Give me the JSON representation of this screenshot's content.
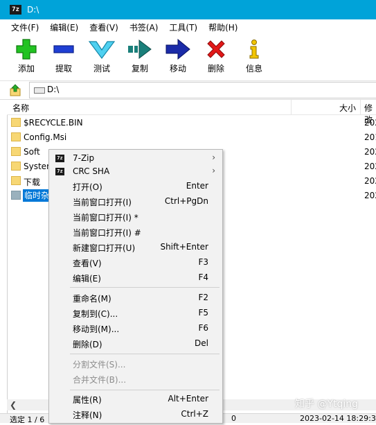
{
  "window": {
    "title": "D:\\",
    "icon_text": "7z"
  },
  "menubar": [
    "文件(F)",
    "编辑(E)",
    "查看(V)",
    "书签(A)",
    "工具(T)",
    "帮助(H)"
  ],
  "toolbar": {
    "add": "添加",
    "extract": "提取",
    "test": "测试",
    "copy": "复制",
    "move": "移动",
    "delete": "删除",
    "info": "信息"
  },
  "address": {
    "path": "D:\\"
  },
  "columns": {
    "name": "名称",
    "size": "大小",
    "modified": "修改"
  },
  "files": [
    {
      "name": "$RECYCLE.BIN",
      "date": "202"
    },
    {
      "name": "Config.Msi",
      "date": "201"
    },
    {
      "name": "Soft",
      "date": "202"
    },
    {
      "name": "System",
      "date": "202"
    },
    {
      "name": "下载",
      "date": "202"
    },
    {
      "name": "临时杂",
      "date": "202"
    }
  ],
  "statusbar": {
    "selected": "选定 1 / 6",
    "size": "0",
    "datetime": "2023-02-14 18:29:3"
  },
  "watermark": "知乎 @Ytqing",
  "context_menu": {
    "items": [
      {
        "label": "7-Zip",
        "icon": "7z",
        "submenu": true
      },
      {
        "label": "CRC SHA",
        "icon": "7z",
        "submenu": true
      },
      {
        "label": "打开(O)",
        "key": "Enter"
      },
      {
        "label": "当前窗口打开(I)",
        "key": "Ctrl+PgDn"
      },
      {
        "label": "当前窗口打开(I) *"
      },
      {
        "label": "当前窗口打开(I) #"
      },
      {
        "label": "新建窗口打开(U)",
        "key": "Shift+Enter"
      },
      {
        "label": "查看(V)",
        "key": "F3"
      },
      {
        "label": "编辑(E)",
        "key": "F4"
      },
      {
        "label": "重命名(M)",
        "key": "F2"
      },
      {
        "label": "复制到(C)...",
        "key": "F5"
      },
      {
        "label": "移动到(M)...",
        "key": "F6"
      },
      {
        "label": "删除(D)",
        "key": "Del"
      },
      {
        "label": "分割文件(S)...",
        "disabled": true
      },
      {
        "label": "合并文件(B)...",
        "disabled": true
      },
      {
        "label": "属性(R)",
        "key": "Alt+Enter"
      },
      {
        "label": "注释(N)",
        "key": "Ctrl+Z"
      }
    ]
  }
}
